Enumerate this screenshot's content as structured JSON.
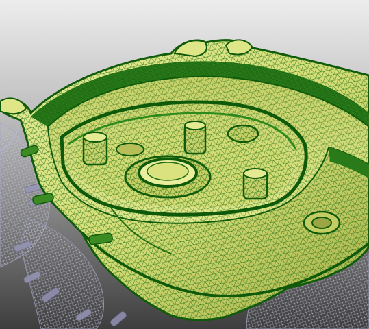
{
  "viewport": {
    "kind": "3d-mesh-viewer",
    "background_top_color": "#e9e9e9",
    "background_bottom_color": "#4a4a4a",
    "mesh_colors": {
      "surface_fill": "#d8e27a",
      "surface_shadow": "#b9c35c",
      "wireframe_edges": "#1c6b12",
      "dense_edges": "#0f5a0a",
      "ghost_assembly": "#b9b9d6"
    }
  }
}
